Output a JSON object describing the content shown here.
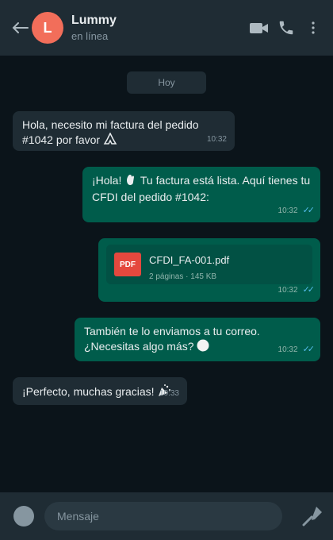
{
  "header": {
    "back_icon": "arrow-left-icon",
    "avatar_letter": "L",
    "avatar_color": "#f26e5a",
    "name": "Lummy",
    "status": "en línea",
    "icons": [
      "video-call-icon",
      "phone-icon",
      "more-options-icon"
    ]
  },
  "chat": {
    "date_label": "Hoy",
    "messages": [
      {
        "direction": "in",
        "text": "Hola, necesito mi factura del pedido #1042 por favor",
        "emoji": "folded-hands",
        "time": "10:32"
      },
      {
        "direction": "out",
        "text_a": "¡Hola!",
        "emoji": "waving-hand",
        "text_b": "Tu factura está lista. Aquí tienes tu CFDI del pedido #1042:",
        "time": "10:32",
        "read": true
      },
      {
        "direction": "out",
        "type": "file",
        "file_badge": "PDF",
        "file_name": "CFDI_FA-001.pdf",
        "file_info": "2 páginas · 145 KB",
        "time": "10:32",
        "read": true
      },
      {
        "direction": "out",
        "text": "También te lo enviamos a tu correo. ¿Necesitas algo más?",
        "emoji": "smiling-face",
        "time": "10:32",
        "read": true
      },
      {
        "direction": "in",
        "text": "¡Perfecto, muchas gracias!",
        "emoji": "party-popper",
        "time": "10:33"
      }
    ]
  },
  "composer": {
    "placeholder": "Mensaje",
    "emoji_icon": "emoji-icon",
    "mic_icon": "microphone-icon"
  },
  "colors": {
    "background": "#0b141a",
    "header": "#1f2c34",
    "incoming": "#1f2c34",
    "outgoing": "#005c4b",
    "read_ticks": "#53bdeb",
    "pdf": "#e5483e"
  }
}
